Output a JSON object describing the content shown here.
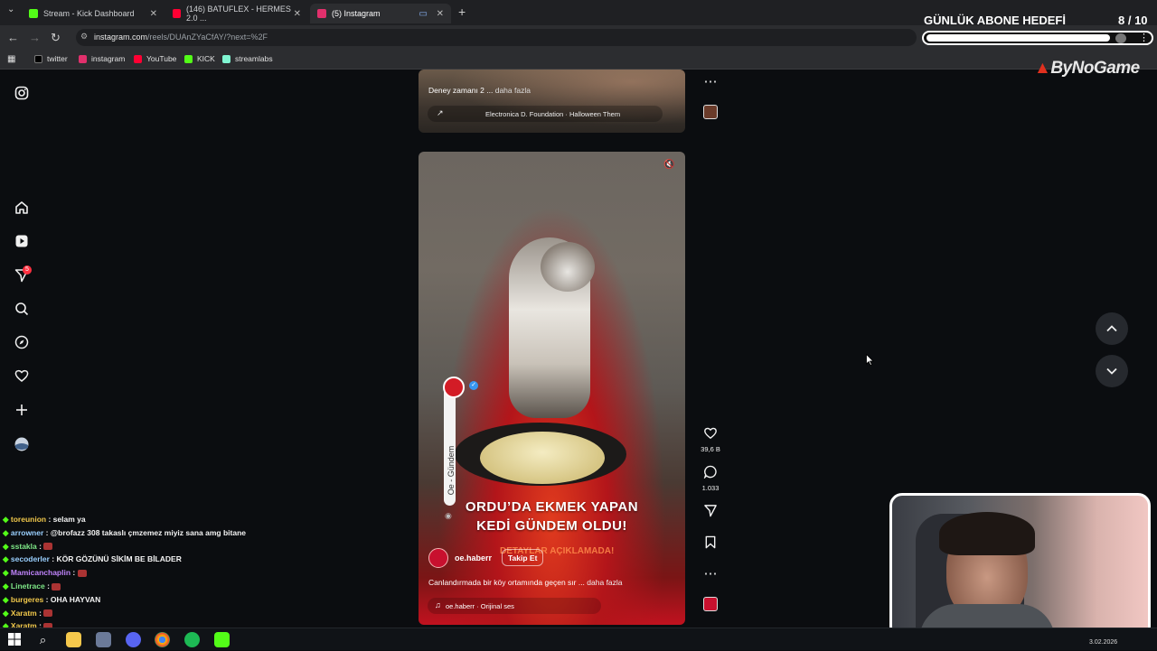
{
  "browser": {
    "tabs": [
      {
        "label": "Stream - Kick Dashboard",
        "color": "#53fc18"
      },
      {
        "label": "(146) BATUFLEX - HERMES 2.0 ...",
        "color": "#ff0033"
      },
      {
        "label": "(5) Instagram",
        "color": "#e1306c"
      }
    ],
    "new_tab": "+",
    "url_host": "instagram.com",
    "url_path": "/reels/DUAnZYaCfAY/?next=%2F",
    "bookmarks": [
      "twitter",
      "instagram",
      "YouTube",
      "KICK",
      "streamlabs"
    ]
  },
  "overlay": {
    "goal_title": "GÜNLÜK ABONE HEDEFİ",
    "goal_count": "8  / 10",
    "goal_fraction": 0.8,
    "brand": "ByNoGame"
  },
  "sidebar": {
    "notification_badge": "5"
  },
  "reel1": {
    "caption": "Deney zamanı 2 ...",
    "more": "daha fazla",
    "audio": "Electronica D. Foundation · Halloween Them"
  },
  "reel2": {
    "headline_line1": "ORDU’DA EKMEK YAPAN",
    "headline_line2": "KEDİ GÜNDEM OLDU!",
    "subline": "DETAYLAR AÇIKLAMADA!",
    "vertical_label": "Oe - Gündem",
    "account": "oe.haberr",
    "follow": "Takip Et",
    "caption": "Canlandırmada bir köy ortamında geçen sır ...",
    "more": "daha fazla",
    "audio": "oe.haberr · Orijinal ses",
    "likes": "39,6 B",
    "comments": "1.033"
  },
  "chat": [
    {
      "user": "toreunion",
      "msg": "selam ya",
      "color": "#f1c84b"
    },
    {
      "user": "arrowner",
      "msg": "@brofazz 308 takaslı çmzemez miyiz sana amg bitane",
      "color": "#9ad0ff"
    },
    {
      "user": "sstakla",
      "msg": "",
      "color": "#7ee787"
    },
    {
      "user": "secoderler",
      "msg": "KÖR GÖZÜNÜ SİKİM BE BİLADER",
      "color": "#9ad0ff"
    },
    {
      "user": "Mamicanchaplin",
      "msg": "",
      "color": "#c084fc"
    },
    {
      "user": "Linetrace",
      "msg": "",
      "color": "#7ee787"
    },
    {
      "user": "burgeres",
      "msg": "OHA HAYVAN",
      "color": "#f1c84b"
    },
    {
      "user": "Xaratm",
      "msg": "",
      "color": "#f1c84b"
    },
    {
      "user": "Xaratm",
      "msg": "",
      "color": "#f1c84b"
    }
  ],
  "taskbar": {
    "date": "3.02.2026"
  }
}
